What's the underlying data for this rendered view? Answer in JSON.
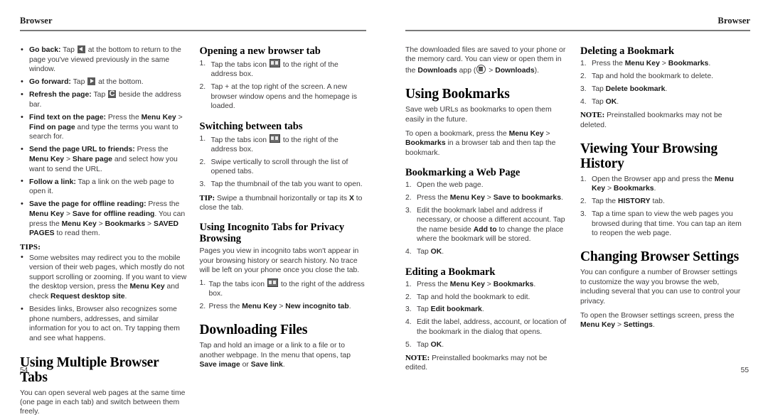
{
  "document": {
    "running_head": "Browser",
    "left_page_number": "54",
    "right_page_number": "55"
  },
  "icons": {
    "back": "back-arrow-icon",
    "forward": "forward-arrow-icon",
    "refresh": "refresh-icon",
    "tabs": "tabs-icon",
    "apps": "apps-grid-icon"
  },
  "left_page": {
    "column1": {
      "bullets": [
        {
          "term": "Go back:",
          "pre": " Tap ",
          "icon": "back",
          "post": " at the bottom to return to the page you've viewed previously in the same window."
        },
        {
          "term": "Go forward:",
          "pre": " Tap ",
          "icon": "forward",
          "post": " at the bottom."
        },
        {
          "term": "Refresh the page:",
          "pre": " Tap ",
          "icon": "refresh",
          "post": " beside the address bar."
        },
        {
          "term": "Find text on the page:",
          "text": " Press the <b>Menu Key</b> &gt; <b>Find on page</b> and type the terms you want to search for."
        },
        {
          "term": "Send the page URL to friends:",
          "text": " Press the <b>Menu Key</b> &gt; <b>Share page</b> and select how you want to send the URL."
        },
        {
          "term": "Follow a link:",
          "text": " Tap a link on the web page to open it."
        },
        {
          "term": "Save the page for offline reading:",
          "text": " Press the <b>Menu Key</b> &gt; <b>Save for offline reading</b>. You can press the <b>Menu Key</b> &gt; <b>Bookmarks</b> &gt; <b>SAVED PAGES</b> to read them."
        }
      ],
      "tips_label": "TIPS:",
      "tips": [
        "Some websites may redirect you to the mobile version of their web pages, which mostly do not support scrolling or zooming. If you want to view the desktop version, press the <b>Menu Key</b> and check <b>Request desktop site</b>.",
        "Besides links, Browser also recognizes some phone numbers, addresses, and similar information for you to act on. Try tapping them and see what happens."
      ],
      "heading_multiple_tabs": "Using Multiple Browser Tabs",
      "multiple_tabs_body": "You can open several web pages at the same time (one page in each tab) and switch between them freely."
    },
    "column2": {
      "heading_open_tab": "Opening a new browser tab",
      "open_tab_steps": [
        {
          "pre": "Tap the tabs icon ",
          "icon": "tabs",
          "post": " to the right of the address box."
        },
        {
          "text": "Tap + at the top right of the screen. A new browser window opens and the homepage is loaded."
        }
      ],
      "heading_switching": "Switching between tabs",
      "switching_steps": [
        {
          "pre": "Tap the tabs icon ",
          "icon": "tabs",
          "post": " to the right of the address box."
        },
        {
          "text": "Swipe vertically to scroll through the list of opened tabs."
        },
        {
          "text": "Tap the thumbnail of the tab you want to open."
        }
      ],
      "tip_label": "TIP:",
      "tip_text": " Swipe a thumbnail horizontally or tap its <b>X</b> to close the tab.",
      "heading_incognito": "Using Incognito Tabs for Privacy Browsing",
      "incognito_body": "Pages you view in incognito tabs won't appear in your browsing history or search history. No trace will be left on your phone once you close the tab.",
      "incognito_steps": [
        {
          "pre": "Tap the tabs icon ",
          "icon": "tabs",
          "post": " to the right of the address box."
        },
        {
          "text": "Press the <b>Menu Key</b> &gt; <b>New incognito tab</b>."
        }
      ],
      "heading_downloading": "Downloading Files",
      "downloading_body": "Tap and hold an image or a link to a file or to another webpage. In the menu that opens, tap <b>Save image</b> or <b>Save link</b>."
    }
  },
  "right_page": {
    "column1": {
      "downloads_pre": "The downloaded files are saved to your phone or the memory card. You can view or open them in the <b>Downloads</b> app (",
      "downloads_icon": "apps",
      "downloads_post": " &gt; <b>Downloads</b>).",
      "heading_bookmarks": "Using Bookmarks",
      "bookmarks_body1": "Save web URLs as bookmarks to open them easily in the future.",
      "bookmarks_body2": "To open a bookmark, press the <b>Menu Key</b> &gt; <b>Bookmarks</b> in a browser tab and then tap the bookmark.",
      "heading_bookmarking": "Bookmarking a Web Page",
      "bookmarking_steps": [
        "Open the web page.",
        "Press the <b>Menu Key</b> &gt; <b>Save to bookmarks</b>.",
        "Edit the bookmark label and address if necessary, or choose a different account. Tap the name beside <b>Add to</b> to change the place where the bookmark will be stored.",
        "Tap <b>OK</b>."
      ],
      "heading_editing": "Editing a Bookmark",
      "editing_steps": [
        "Press the <b>Menu Key</b> &gt; <b>Bookmarks</b>.",
        "Tap and hold the bookmark to edit.",
        "Tap <b>Edit bookmark</b>.",
        "Edit the label, address, account, or location of the bookmark in the dialog that opens.",
        "Tap <b>OK</b>."
      ],
      "note_label": "NOTE:",
      "note_text": " Preinstalled bookmarks may not be edited."
    },
    "column2": {
      "heading_deleting": "Deleting a Bookmark",
      "deleting_steps": [
        "Press the <b>Menu Key</b> &gt; <b>Bookmarks</b>.",
        "Tap and hold the bookmark to delete.",
        "Tap <b>Delete bookmark</b>.",
        "Tap <b>OK</b>."
      ],
      "note_label": "NOTE:",
      "note_text": " Preinstalled bookmarks may not be deleted.",
      "heading_history": "Viewing Your Browsing History",
      "history_steps": [
        "Open the Browser app and press the <b>Menu Key</b> &gt; <b>Bookmarks</b>.",
        "Tap the <b>HISTORY</b> tab.",
        "Tap a time span to view the web pages you browsed during that time. You can tap an item to reopen the web page."
      ],
      "heading_settings": "Changing Browser Settings",
      "settings_body1": "You can configure a number of Browser settings to customize the way you browse the web, including several that you can use to control your privacy.",
      "settings_body2": "To open the Browser settings screen, press the <b>Menu Key</b> &gt; <b>Settings</b>."
    }
  }
}
